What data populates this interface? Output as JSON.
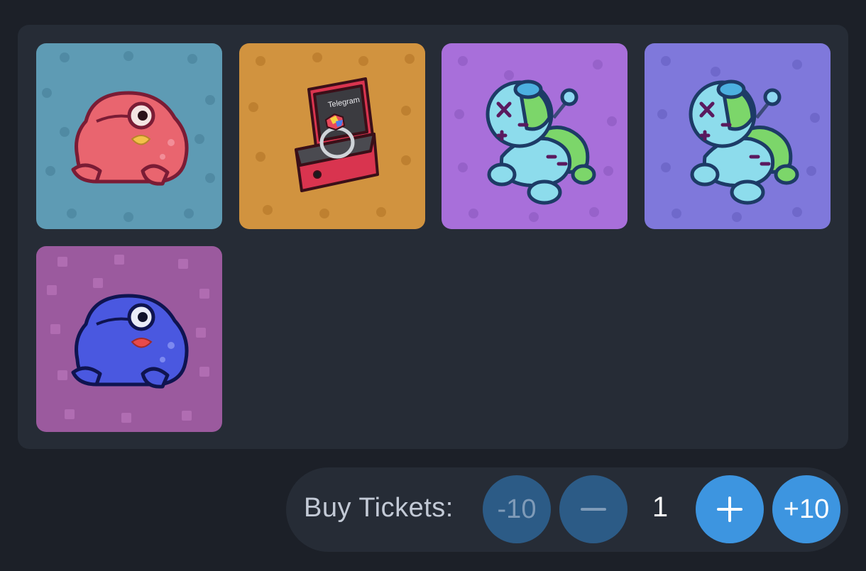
{
  "gifts": [
    {
      "name": "pink frog",
      "icon": "pink-frog-icon",
      "background": "#5e9bb4"
    },
    {
      "name": "ring box",
      "icon": "ring-box-icon",
      "background": "#d1933f",
      "box_text": "Telegram"
    },
    {
      "name": "voodoo doll violet",
      "icon": "voodoo-doll-icon",
      "background": "#a86fda"
    },
    {
      "name": "voodoo doll blue",
      "icon": "voodoo-doll-icon",
      "background": "#7f78db"
    },
    {
      "name": "blue frog",
      "icon": "blue-frog-icon",
      "background": "#9b5a9e"
    }
  ],
  "tickets": {
    "label": "Buy Tickets:",
    "minus_ten": "-10",
    "quantity": "1",
    "plus_ten": "+10",
    "minus_icon": "minus-icon",
    "plus_icon": "plus-icon"
  },
  "colors": {
    "page_bg": "#1c2028",
    "panel_bg": "#262c36",
    "button_active": "#3d95e0",
    "button_disabled": "#2c5b86"
  }
}
